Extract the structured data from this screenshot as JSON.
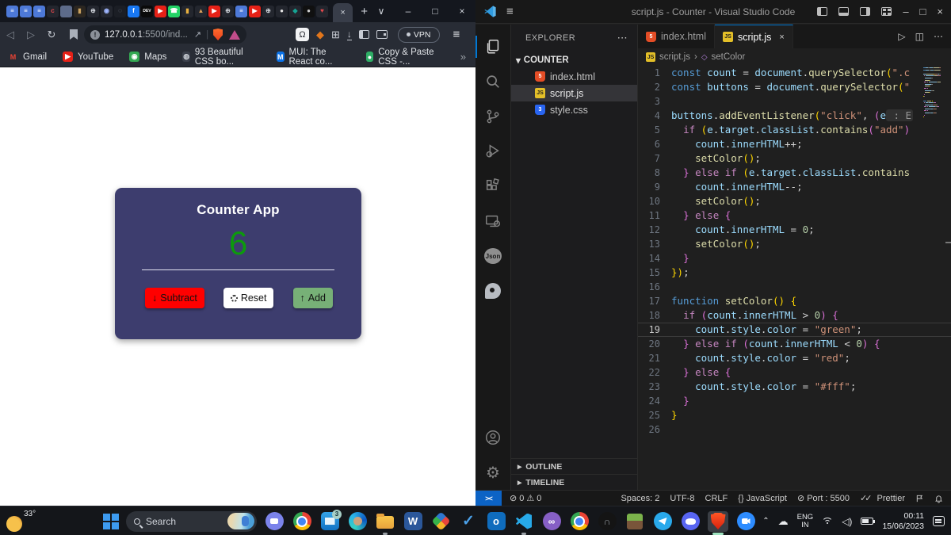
{
  "browser": {
    "active_tab_close": "×",
    "new_tab": "+",
    "window_controls": {
      "tab_search": "∨",
      "minimize": "–",
      "maximize": "□",
      "close": "×"
    },
    "favicons": [
      {
        "bg": "#4d79d8",
        "fg": "#ffffff",
        "g": "≡"
      },
      {
        "bg": "#4d79d8",
        "fg": "#ffffff",
        "g": "≡"
      },
      {
        "bg": "#4d79d8",
        "fg": "#ffffff",
        "g": "≡"
      },
      {
        "bg": "#23262e",
        "fg": "#e5484d",
        "g": "c"
      },
      {
        "bg": "#5d6b8a",
        "fg": "#dfe3ea",
        "g": ""
      },
      {
        "bg": "#2b2620",
        "fg": "#c9a15f",
        "g": "▮"
      },
      {
        "bg": "#23262e",
        "fg": "#cfd3da",
        "g": "⊕"
      },
      {
        "bg": "#23262e",
        "fg": "#9fb6ff",
        "g": "◉"
      },
      {
        "bg": "#1b1e25",
        "fg": "#8892a6",
        "g": "◌"
      },
      {
        "bg": "#1877f2",
        "fg": "#ffffff",
        "g": "f"
      },
      {
        "bg": "#0a0a0a",
        "fg": "#ffffff",
        "g": "DEV"
      },
      {
        "bg": "#e62117",
        "fg": "#ffffff",
        "g": "▶"
      },
      {
        "bg": "#23d366",
        "fg": "#ffffff",
        "g": "☎"
      },
      {
        "bg": "#23262e",
        "fg": "#e8b13f",
        "g": "▮"
      },
      {
        "bg": "#23262e",
        "fg": "#d9a05b",
        "g": "▲"
      },
      {
        "bg": "#e62117",
        "fg": "#ffffff",
        "g": "▶"
      },
      {
        "bg": "#23262e",
        "fg": "#cfd3da",
        "g": "⊕"
      },
      {
        "bg": "#4d79d8",
        "fg": "#ffffff",
        "g": "≡"
      },
      {
        "bg": "#e62117",
        "fg": "#ffffff",
        "g": "▶"
      },
      {
        "bg": "#23262e",
        "fg": "#cfd3da",
        "g": "⊕"
      },
      {
        "bg": "#23262e",
        "fg": "#e6e6e6",
        "g": "●"
      },
      {
        "bg": "#23262e",
        "fg": "#16a394",
        "g": "◆"
      },
      {
        "bg": "#101010",
        "fg": "#d0d0d0",
        "g": "●"
      },
      {
        "bg": "#23262e",
        "fg": "#e5484d",
        "g": "♥"
      }
    ],
    "toolbar": {
      "url_host": "127.0.0.1",
      "url_path": ":5500/ind...",
      "vpn_label": "VPN",
      "omega_glyph": "Ω"
    },
    "bookmarks": [
      {
        "label": "Gmail",
        "icon": "gmail",
        "bg": "transparent",
        "fg": "#ea4335",
        "g": "M"
      },
      {
        "label": "YouTube",
        "icon": "youtube",
        "bg": "#e62117",
        "fg": "#ffffff",
        "g": "▶"
      },
      {
        "label": "Maps",
        "icon": "maps",
        "bg": "#34a853",
        "fg": "#ffffff",
        "g": "◉"
      },
      {
        "label": "93 Beautiful CSS bo...",
        "icon": "site",
        "bg": "#3a3f4a",
        "fg": "#cfd3da",
        "g": "◍"
      },
      {
        "label": "MUI: The React co...",
        "icon": "mui",
        "bg": "#0a72e8",
        "fg": "#ffffff",
        "g": "M"
      },
      {
        "label": "Copy & Paste CSS -...",
        "icon": "copycss",
        "bg": "#2fae66",
        "fg": "#ffffff",
        "g": "●"
      }
    ],
    "bookmarks_overflow": "»"
  },
  "counter_app": {
    "title": "Counter App",
    "count": "6",
    "count_color": "#0c9a0c",
    "card_color": "#3d3d6e",
    "buttons": [
      {
        "label": "Subtract",
        "icon": "arrow-down",
        "glyph": "↓",
        "bg": "#ff0000"
      },
      {
        "label": "Reset",
        "icon": "dotted-spinner",
        "glyph": "",
        "bg": "#ffffff"
      },
      {
        "label": "Add",
        "icon": "arrow-up",
        "glyph": "↑",
        "bg": "#77b077"
      }
    ]
  },
  "vscode": {
    "title": "script.js - Counter - Visual Studio Code",
    "activity_bar": [
      "explorer",
      "search",
      "source-control",
      "run-debug",
      "extensions",
      "live-server",
      "json-crack",
      "quokka",
      "accounts",
      "settings"
    ],
    "explorer": {
      "header": "EXPLORER",
      "folder": "COUNTER",
      "files": [
        {
          "name": "index.html",
          "icon": "html",
          "glyph": "5",
          "selected": false
        },
        {
          "name": "script.js",
          "icon": "js",
          "glyph": "JS",
          "selected": true
        },
        {
          "name": "style.css",
          "icon": "css",
          "glyph": "3",
          "selected": false
        }
      ],
      "sections": [
        "OUTLINE",
        "TIMELINE"
      ]
    },
    "tabs": [
      {
        "name": "index.html",
        "icon": "html",
        "glyph": "5",
        "active": false,
        "close": ""
      },
      {
        "name": "script.js",
        "icon": "js",
        "glyph": "JS",
        "active": true,
        "close": "×"
      }
    ],
    "breadcrumb": {
      "file": "script.js",
      "sep": "›",
      "symbol": "setColor"
    },
    "code": {
      "active_line": 19,
      "lines": [
        [
          [
            "kw",
            "const"
          ],
          [
            "pl",
            " "
          ],
          [
            "v",
            "count"
          ],
          [
            "pl",
            " = "
          ],
          [
            "v",
            "document"
          ],
          [
            "pl",
            "."
          ],
          [
            "fn",
            "querySelector"
          ],
          [
            "b1",
            "("
          ],
          [
            "str",
            "\".c"
          ]
        ],
        [
          [
            "kw",
            "const"
          ],
          [
            "pl",
            " "
          ],
          [
            "v",
            "buttons"
          ],
          [
            "pl",
            " = "
          ],
          [
            "v",
            "document"
          ],
          [
            "pl",
            "."
          ],
          [
            "fn",
            "querySelector"
          ],
          [
            "b1",
            "("
          ],
          [
            "str",
            "\""
          ]
        ],
        [],
        [
          [
            "v",
            "buttons"
          ],
          [
            "pl",
            "."
          ],
          [
            "fn",
            "addEventListener"
          ],
          [
            "b1",
            "("
          ],
          [
            "str",
            "\"click\""
          ],
          [
            "pl",
            ", "
          ],
          [
            "b2",
            "("
          ],
          [
            "v",
            "e"
          ],
          [
            "hint",
            " : E"
          ]
        ],
        [
          [
            "pl",
            "  "
          ],
          [
            "ctrl",
            "if"
          ],
          [
            "pl",
            " "
          ],
          [
            "b1",
            "("
          ],
          [
            "v",
            "e"
          ],
          [
            "pl",
            "."
          ],
          [
            "v",
            "target"
          ],
          [
            "pl",
            "."
          ],
          [
            "v",
            "classList"
          ],
          [
            "pl",
            "."
          ],
          [
            "fn",
            "contains"
          ],
          [
            "b2",
            "("
          ],
          [
            "str",
            "\"add\""
          ],
          [
            "b2",
            ")"
          ]
        ],
        [
          [
            "pl",
            "    "
          ],
          [
            "v",
            "count"
          ],
          [
            "pl",
            "."
          ],
          [
            "v",
            "innerHTML"
          ],
          [
            "pl",
            "++;"
          ]
        ],
        [
          [
            "pl",
            "    "
          ],
          [
            "fn",
            "setColor"
          ],
          [
            "b1",
            "()"
          ],
          [
            "pl",
            ";"
          ]
        ],
        [
          [
            "pl",
            "  "
          ],
          [
            "b2",
            "}"
          ],
          [
            "pl",
            " "
          ],
          [
            "ctrl",
            "else"
          ],
          [
            "pl",
            " "
          ],
          [
            "ctrl",
            "if"
          ],
          [
            "pl",
            " "
          ],
          [
            "b1",
            "("
          ],
          [
            "v",
            "e"
          ],
          [
            "pl",
            "."
          ],
          [
            "v",
            "target"
          ],
          [
            "pl",
            "."
          ],
          [
            "v",
            "classList"
          ],
          [
            "pl",
            "."
          ],
          [
            "fn",
            "contains"
          ]
        ],
        [
          [
            "pl",
            "    "
          ],
          [
            "v",
            "count"
          ],
          [
            "pl",
            "."
          ],
          [
            "v",
            "innerHTML"
          ],
          [
            "pl",
            "--;"
          ]
        ],
        [
          [
            "pl",
            "    "
          ],
          [
            "fn",
            "setColor"
          ],
          [
            "b1",
            "()"
          ],
          [
            "pl",
            ";"
          ]
        ],
        [
          [
            "pl",
            "  "
          ],
          [
            "b2",
            "}"
          ],
          [
            "pl",
            " "
          ],
          [
            "ctrl",
            "else"
          ],
          [
            "pl",
            " "
          ],
          [
            "b2",
            "{"
          ]
        ],
        [
          [
            "pl",
            "    "
          ],
          [
            "v",
            "count"
          ],
          [
            "pl",
            "."
          ],
          [
            "v",
            "innerHTML"
          ],
          [
            "pl",
            " = "
          ],
          [
            "num",
            "0"
          ],
          [
            "pl",
            ";"
          ]
        ],
        [
          [
            "pl",
            "    "
          ],
          [
            "fn",
            "setColor"
          ],
          [
            "b1",
            "()"
          ],
          [
            "pl",
            ";"
          ]
        ],
        [
          [
            "pl",
            "  "
          ],
          [
            "b2",
            "}"
          ]
        ],
        [
          [
            "b1",
            "}"
          ],
          [
            "b1",
            ")"
          ],
          [
            "pl",
            ";"
          ]
        ],
        [],
        [
          [
            "kw",
            "function"
          ],
          [
            "pl",
            " "
          ],
          [
            "fn",
            "setColor"
          ],
          [
            "b1",
            "()"
          ],
          [
            "pl",
            " "
          ],
          [
            "b1",
            "{"
          ]
        ],
        [
          [
            "pl",
            "  "
          ],
          [
            "ctrl",
            "if"
          ],
          [
            "pl",
            " "
          ],
          [
            "b2",
            "("
          ],
          [
            "v",
            "count"
          ],
          [
            "pl",
            "."
          ],
          [
            "v",
            "innerHTML"
          ],
          [
            "pl",
            " > "
          ],
          [
            "num",
            "0"
          ],
          [
            "b2",
            ")"
          ],
          [
            "pl",
            " "
          ],
          [
            "b2",
            "{"
          ]
        ],
        [
          [
            "pl",
            "    "
          ],
          [
            "v",
            "count"
          ],
          [
            "pl",
            "."
          ],
          [
            "v",
            "style"
          ],
          [
            "pl",
            "."
          ],
          [
            "v",
            "color"
          ],
          [
            "pl",
            " = "
          ],
          [
            "str",
            "\"green\""
          ],
          [
            "pl",
            ";"
          ]
        ],
        [
          [
            "pl",
            "  "
          ],
          [
            "b2",
            "}"
          ],
          [
            "pl",
            " "
          ],
          [
            "ctrl",
            "else"
          ],
          [
            "pl",
            " "
          ],
          [
            "ctrl",
            "if"
          ],
          [
            "pl",
            " "
          ],
          [
            "b2",
            "("
          ],
          [
            "v",
            "count"
          ],
          [
            "pl",
            "."
          ],
          [
            "v",
            "innerHTML"
          ],
          [
            "pl",
            " < "
          ],
          [
            "num",
            "0"
          ],
          [
            "b2",
            ")"
          ],
          [
            "pl",
            " "
          ],
          [
            "b2",
            "{"
          ]
        ],
        [
          [
            "pl",
            "    "
          ],
          [
            "v",
            "count"
          ],
          [
            "pl",
            "."
          ],
          [
            "v",
            "style"
          ],
          [
            "pl",
            "."
          ],
          [
            "v",
            "color"
          ],
          [
            "pl",
            " = "
          ],
          [
            "str",
            "\"red\""
          ],
          [
            "pl",
            ";"
          ]
        ],
        [
          [
            "pl",
            "  "
          ],
          [
            "b2",
            "}"
          ],
          [
            "pl",
            " "
          ],
          [
            "ctrl",
            "else"
          ],
          [
            "pl",
            " "
          ],
          [
            "b2",
            "{"
          ]
        ],
        [
          [
            "pl",
            "    "
          ],
          [
            "v",
            "count"
          ],
          [
            "pl",
            "."
          ],
          [
            "v",
            "style"
          ],
          [
            "pl",
            "."
          ],
          [
            "v",
            "color"
          ],
          [
            "pl",
            " = "
          ],
          [
            "str",
            "\"#fff\""
          ],
          [
            "pl",
            ";"
          ]
        ],
        [
          [
            "pl",
            "  "
          ],
          [
            "b2",
            "}"
          ]
        ],
        [
          [
            "b1",
            "}"
          ]
        ],
        []
      ]
    },
    "status_bar": {
      "errors": "0",
      "warnings": "0",
      "spaces": "Spaces: 2",
      "encoding": "UTF-8",
      "eol": "CRLF",
      "language": "JavaScript",
      "lang_prefix": "{}",
      "port": "Port : 5500",
      "prettier": "Prettier"
    }
  },
  "taskbar": {
    "weather_temp": "33°",
    "search_placeholder": "Search",
    "apps": [
      {
        "name": "chat",
        "cls": "tb-chat",
        "letter": "",
        "badge": "",
        "running": false,
        "active": false
      },
      {
        "name": "chrome",
        "cls": "tb-chrome",
        "letter": "",
        "badge": "",
        "running": false,
        "active": false
      },
      {
        "name": "mail",
        "cls": "tb-mail",
        "letter": "",
        "badge": "3",
        "running": false,
        "active": false
      },
      {
        "name": "edge",
        "cls": "tb-edge",
        "letter": "",
        "badge": "",
        "running": false,
        "active": false
      },
      {
        "name": "file-explorer",
        "cls": "tb-folder",
        "letter": "",
        "badge": "",
        "running": true,
        "active": false
      },
      {
        "name": "word",
        "cls": "tb-word",
        "letter": "W",
        "badge": "",
        "running": false,
        "active": false
      },
      {
        "name": "office",
        "cls": "tb-office",
        "letter": "",
        "badge": "",
        "running": false,
        "active": false
      },
      {
        "name": "todo",
        "cls": "tb-todo",
        "letter": "✓",
        "badge": "",
        "running": false,
        "active": false
      },
      {
        "name": "outlook",
        "cls": "tb-outlook",
        "letter": "o",
        "badge": "",
        "running": false,
        "active": false
      },
      {
        "name": "vscode",
        "cls": "tb-vscode",
        "letter": "",
        "badge": "",
        "running": true,
        "active": false
      },
      {
        "name": "visual-studio",
        "cls": "tb-vs",
        "letter": "∞",
        "badge": "",
        "running": false,
        "active": false
      },
      {
        "name": "chrome-2",
        "cls": "tb-chrome",
        "letter": "",
        "badge": "",
        "running": false,
        "active": false
      },
      {
        "name": "headphones",
        "cls": "tb-headphones",
        "letter": "∩",
        "badge": "",
        "running": false,
        "active": false
      },
      {
        "name": "minecraft",
        "cls": "tb-minecraft",
        "letter": "",
        "badge": "",
        "running": false,
        "active": false
      },
      {
        "name": "telegram",
        "cls": "tb-telegram",
        "letter": "",
        "badge": "",
        "running": false,
        "active": false
      },
      {
        "name": "discord",
        "cls": "tb-discord",
        "letter": "",
        "badge": "",
        "running": false,
        "active": false
      },
      {
        "name": "brave",
        "cls": "tb-brave",
        "letter": "",
        "badge": "",
        "running": true,
        "active": true
      },
      {
        "name": "zoom",
        "cls": "tb-zoom",
        "letter": "",
        "badge": "",
        "running": false,
        "active": false
      }
    ],
    "tray": {
      "lang_top": "ENG",
      "lang_bottom": "IN",
      "time": "00:11",
      "date": "15/06/2023"
    }
  }
}
